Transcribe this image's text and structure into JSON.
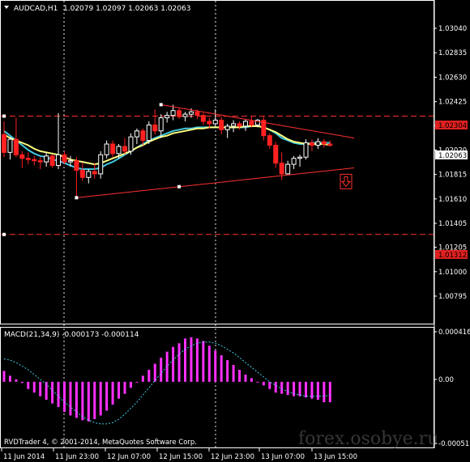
{
  "header": {
    "symbol_timeframe": "AUDCAD,H1",
    "ohlc": "1.02079 1.02097 1.02063 1.02063",
    "menu_icon": "triangle-down-icon"
  },
  "price_axis": {
    "labels": [
      "1.03040",
      "1.02835",
      "1.02630",
      "1.02425",
      "1.02225",
      "1.02020",
      "1.01815",
      "1.01610",
      "1.01405",
      "1.01205",
      "1.01000",
      "1.00795"
    ],
    "current_price": "1.02063",
    "resistance_level": "1.02304",
    "support_level": "1.01312"
  },
  "macd": {
    "label": "MACD(21,34,9) -0.000173 -0.000114",
    "axis_top": "0.000416",
    "axis_zero": "0.00",
    "axis_bottom": "-0.000512"
  },
  "time_axis": {
    "labels": [
      "11 Jun 2014",
      "11 Jun 23:00",
      "12 Jun 07:00",
      "12 Jun 15:00",
      "12 Jun 23:00",
      "13 Jun 07:00",
      "13 Jun 15:00"
    ]
  },
  "copyright": "RVDTrader 4, © 2001-2014, MetaQuotes Software Corp.",
  "watermark": "forex.osobye.ru",
  "colors": {
    "background": "#000000",
    "grid": "#ffffff",
    "bull_candle": "#ffffff",
    "bear_candle": "#ff2020",
    "ma_fast": "#ffff80",
    "ma_slow": "#40c8e0",
    "trendline": "#ff3030",
    "macd_hist": "#ff30ff",
    "macd_signal": "#40c8e0"
  },
  "chart_data": {
    "type": "candlestick",
    "ylim": [
      1.00795,
      1.0304
    ],
    "candles": [
      {
        "o": 1.0215,
        "h": 1.0226,
        "l": 1.0196,
        "c": 1.02
      },
      {
        "o": 1.02,
        "h": 1.0213,
        "l": 1.0194,
        "c": 1.0211
      },
      {
        "o": 1.0211,
        "h": 1.0229,
        "l": 1.0196,
        "c": 1.0198
      },
      {
        "o": 1.0198,
        "h": 1.0201,
        "l": 1.0187,
        "c": 1.0195
      },
      {
        "o": 1.0195,
        "h": 1.02,
        "l": 1.019,
        "c": 1.0194
      },
      {
        "o": 1.0194,
        "h": 1.0197,
        "l": 1.0189,
        "c": 1.0193
      },
      {
        "o": 1.0193,
        "h": 1.0196,
        "l": 1.0186,
        "c": 1.0192
      },
      {
        "o": 1.0192,
        "h": 1.02,
        "l": 1.0188,
        "c": 1.0197
      },
      {
        "o": 1.0197,
        "h": 1.0198,
        "l": 1.0187,
        "c": 1.0189
      },
      {
        "o": 1.0189,
        "h": 1.0233,
        "l": 1.0186,
        "c": 1.0198
      },
      {
        "o": 1.0198,
        "h": 1.0201,
        "l": 1.019,
        "c": 1.0192
      },
      {
        "o": 1.0192,
        "h": 1.0197,
        "l": 1.0188,
        "c": 1.0193
      },
      {
        "o": 1.0193,
        "h": 1.0196,
        "l": 1.0162,
        "c": 1.0185
      },
      {
        "o": 1.0185,
        "h": 1.0191,
        "l": 1.0176,
        "c": 1.0179
      },
      {
        "o": 1.0179,
        "h": 1.0186,
        "l": 1.0174,
        "c": 1.0184
      },
      {
        "o": 1.0184,
        "h": 1.0191,
        "l": 1.0178,
        "c": 1.0182
      },
      {
        "o": 1.0182,
        "h": 1.0201,
        "l": 1.0178,
        "c": 1.0198
      },
      {
        "o": 1.0198,
        "h": 1.021,
        "l": 1.0195,
        "c": 1.0207
      },
      {
        "o": 1.0207,
        "h": 1.021,
        "l": 1.0196,
        "c": 1.0199
      },
      {
        "o": 1.0199,
        "h": 1.0207,
        "l": 1.0195,
        "c": 1.0205
      },
      {
        "o": 1.0205,
        "h": 1.0212,
        "l": 1.0198,
        "c": 1.0201
      },
      {
        "o": 1.0201,
        "h": 1.0216,
        "l": 1.0198,
        "c": 1.0213
      },
      {
        "o": 1.0213,
        "h": 1.022,
        "l": 1.0207,
        "c": 1.0218
      },
      {
        "o": 1.0218,
        "h": 1.022,
        "l": 1.0206,
        "c": 1.021
      },
      {
        "o": 1.021,
        "h": 1.0226,
        "l": 1.0207,
        "c": 1.0223
      },
      {
        "o": 1.0223,
        "h": 1.0236,
        "l": 1.0215,
        "c": 1.0218
      },
      {
        "o": 1.0218,
        "h": 1.0232,
        "l": 1.0212,
        "c": 1.0229
      },
      {
        "o": 1.0229,
        "h": 1.0234,
        "l": 1.0225,
        "c": 1.0231
      },
      {
        "o": 1.0231,
        "h": 1.024,
        "l": 1.0227,
        "c": 1.0235
      },
      {
        "o": 1.0235,
        "h": 1.0237,
        "l": 1.0228,
        "c": 1.023
      },
      {
        "o": 1.023,
        "h": 1.0234,
        "l": 1.0226,
        "c": 1.0232
      },
      {
        "o": 1.0232,
        "h": 1.0237,
        "l": 1.0229,
        "c": 1.0234
      },
      {
        "o": 1.0234,
        "h": 1.0236,
        "l": 1.0228,
        "c": 1.0231
      },
      {
        "o": 1.0231,
        "h": 1.0233,
        "l": 1.0223,
        "c": 1.0226
      },
      {
        "o": 1.0226,
        "h": 1.0229,
        "l": 1.022,
        "c": 1.0224
      },
      {
        "o": 1.0224,
        "h": 1.0236,
        "l": 1.0221,
        "c": 1.0227
      },
      {
        "o": 1.0227,
        "h": 1.023,
        "l": 1.0215,
        "c": 1.0219
      },
      {
        "o": 1.0219,
        "h": 1.0224,
        "l": 1.0212,
        "c": 1.0222
      },
      {
        "o": 1.0222,
        "h": 1.0227,
        "l": 1.0217,
        "c": 1.0224
      },
      {
        "o": 1.0224,
        "h": 1.0226,
        "l": 1.0219,
        "c": 1.0222
      },
      {
        "o": 1.0222,
        "h": 1.0228,
        "l": 1.0218,
        "c": 1.0226
      },
      {
        "o": 1.0226,
        "h": 1.023,
        "l": 1.0221,
        "c": 1.0223
      },
      {
        "o": 1.0223,
        "h": 1.0228,
        "l": 1.0221,
        "c": 1.0227
      },
      {
        "o": 1.0227,
        "h": 1.023,
        "l": 1.021,
        "c": 1.0214
      },
      {
        "o": 1.0214,
        "h": 1.0216,
        "l": 1.0203,
        "c": 1.0206
      },
      {
        "o": 1.0206,
        "h": 1.0209,
        "l": 1.0187,
        "c": 1.0191
      },
      {
        "o": 1.0191,
        "h": 1.02,
        "l": 1.0177,
        "c": 1.0182
      },
      {
        "o": 1.0182,
        "h": 1.0193,
        "l": 1.0181,
        "c": 1.019
      },
      {
        "o": 1.019,
        "h": 1.0197,
        "l": 1.0186,
        "c": 1.0195
      },
      {
        "o": 1.0195,
        "h": 1.0198,
        "l": 1.0188,
        "c": 1.0196
      },
      {
        "o": 1.0196,
        "h": 1.0211,
        "l": 1.0194,
        "c": 1.0208
      },
      {
        "o": 1.0208,
        "h": 1.0211,
        "l": 1.0201,
        "c": 1.0206
      },
      {
        "o": 1.0206,
        "h": 1.0212,
        "l": 1.0203,
        "c": 1.0209
      },
      {
        "o": 1.0209,
        "h": 1.0211,
        "l": 1.0204,
        "c": 1.0207
      },
      {
        "o": 1.0207,
        "h": 1.021,
        "l": 1.0205,
        "c": 1.0206
      }
    ],
    "ma_fast": [
      1.0215,
      1.0212,
      1.021,
      1.0208,
      1.0206,
      1.0203,
      1.0201,
      1.02,
      1.0199,
      1.0198,
      1.0196,
      1.0194,
      1.0193,
      1.0192,
      1.0191,
      1.019,
      1.0191,
      1.0193,
      1.0195,
      1.0197,
      1.0199,
      1.0201,
      1.0204,
      1.0206,
      1.0209,
      1.0211,
      1.0213,
      1.0214,
      1.0216,
      1.0217,
      1.0218,
      1.0219,
      1.022,
      1.022,
      1.0221,
      1.0221,
      1.0221,
      1.0221,
      1.0221,
      1.0221,
      1.0222,
      1.0222,
      1.0222,
      1.0221,
      1.0219,
      1.0217,
      1.0214,
      1.0211,
      1.0209,
      1.0208,
      1.0207,
      1.0207,
      1.0207,
      1.0207,
      1.0206
    ],
    "ma_slow": [
      1.0218,
      1.0214,
      1.021,
      1.0206,
      1.0202,
      1.0199,
      1.0197,
      1.0196,
      1.0194,
      1.0193,
      1.0191,
      1.0189,
      1.0187,
      1.0186,
      1.0186,
      1.0186,
      1.0187,
      1.019,
      1.0192,
      1.0195,
      1.0198,
      1.0201,
      1.0204,
      1.0207,
      1.021,
      1.0212,
      1.0214,
      1.0216,
      1.0218,
      1.0219,
      1.022,
      1.022,
      1.0221,
      1.0221,
      1.0221,
      1.0221,
      1.0221,
      1.0221,
      1.0221,
      1.0221,
      1.0221,
      1.0222,
      1.0222,
      1.0221,
      1.0219,
      1.0216,
      1.0212,
      1.021,
      1.0208,
      1.0207,
      1.0207,
      1.0208,
      1.0208,
      1.0208,
      1.0208
    ],
    "macd_ylim": [
      -0.000512,
      0.000416
    ],
    "macd_hist": [
      9e-05,
      5e-05,
      2e-05,
      -1e-05,
      -6e-05,
      -9e-05,
      -0.00012,
      -0.00015,
      -0.00018,
      -0.00021,
      -0.00025,
      -0.00028,
      -0.0003,
      -0.00032,
      -0.00033,
      -0.00031,
      -0.00028,
      -0.00024,
      -0.00019,
      -0.00014,
      -0.0001,
      -5e-05,
      0.0,
      5e-05,
      0.0001,
      0.00015,
      0.0002,
      0.00025,
      0.00029,
      0.00032,
      0.00036,
      0.00037,
      0.00036,
      0.00034,
      0.0003,
      0.00026,
      0.00022,
      0.00018,
      0.00014,
      0.0001,
      6e-05,
      3e-05,
      0.0,
      -3e-05,
      -6e-05,
      -9e-05,
      -0.0001,
      -0.00011,
      -0.00012,
      -0.00012,
      -0.00013,
      -0.00014,
      -0.00015,
      -0.00017,
      -0.00017
    ],
    "macd_signal": [
      0.00019,
      0.00018,
      0.00016,
      0.00013,
      0.0001,
      6e-05,
      2e-05,
      -2e-05,
      -7e-05,
      -0.00012,
      -0.00017,
      -0.00021,
      -0.00025,
      -0.00029,
      -0.00032,
      -0.00034,
      -0.00035,
      -0.00035,
      -0.00034,
      -0.00031,
      -0.00027,
      -0.00022,
      -0.00017,
      -0.00011,
      -5e-05,
      1e-05,
      7e-05,
      0.00013,
      0.00018,
      0.00023,
      0.00027,
      0.0003,
      0.00032,
      0.00033,
      0.00033,
      0.00032,
      0.0003,
      0.00027,
      0.00024,
      0.0002,
      0.00016,
      0.00012,
      8e-05,
      4e-05,
      0.0,
      -3e-05,
      -6e-05,
      -8e-05,
      -0.0001,
      -0.00011,
      -0.00012,
      -0.00012,
      -0.00012,
      -0.00012,
      -0.00011
    ],
    "levels": [
      1.02304,
      1.01312
    ],
    "trendlines": [
      {
        "from_bar": 26,
        "from": 1.024,
        "to_bar": 58,
        "to": 1.0212
      },
      {
        "from_bar": 12,
        "from": 1.0162,
        "to_bar": 58,
        "to": 1.0187
      }
    ],
    "arrow": {
      "bar": 49,
      "price": 1.0181
    }
  }
}
